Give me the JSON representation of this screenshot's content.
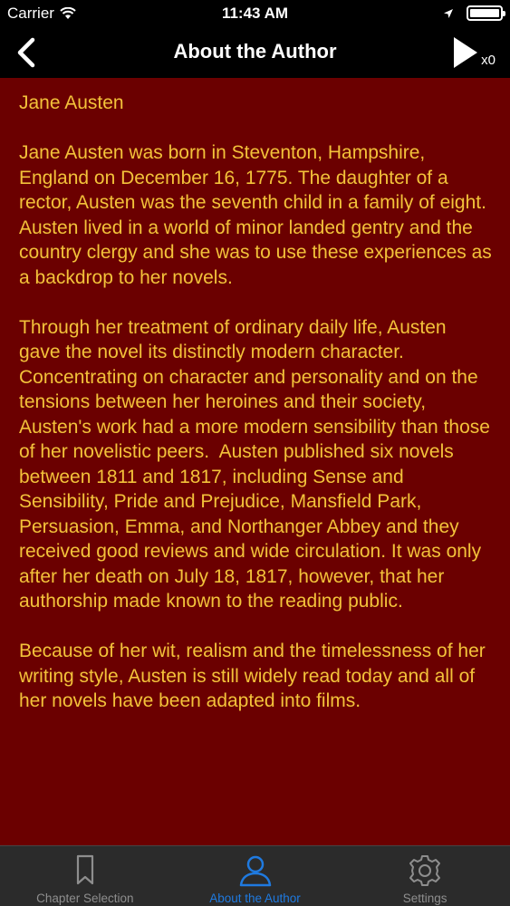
{
  "status_bar": {
    "carrier": "Carrier",
    "time": "11:43 AM",
    "battery_level": 1.0
  },
  "nav": {
    "title": "About the Author",
    "play_count": "x0"
  },
  "content": {
    "author_name": "Jane Austen",
    "paragraphs": [
      "Jane Austen was born in Steventon, Hampshire, England on December 16, 1775. The daughter of a rector, Austen was the seventh child in a family of eight. Austen lived in a world of minor landed gentry and the country clergy and she was to use these experiences as a backdrop to her novels.",
      "Through her treatment of ordinary daily life, Austen gave the novel its distinctly modern character. Concentrating on character and personality and on the tensions between her heroines and their society, Austen's work had a more modern sensibility than those of her novelistic peers.  Austen published six novels between 1811 and 1817, including Sense and Sensibility, Pride and Prejudice, Mansfield Park, Persuasion, Emma, and Northanger Abbey and they received good reviews and wide circulation. It was only after her death on July 18, 1817, however, that her authorship made known to the reading public.",
      "Because of her wit, realism and the timelessness of her writing style, Austen is still widely read today and all of her novels have been adapted into films."
    ]
  },
  "tabs": [
    {
      "label": "Chapter Selection",
      "icon": "bookmark-icon",
      "active": false
    },
    {
      "label": "About the Author",
      "icon": "person-icon",
      "active": true
    },
    {
      "label": "Settings",
      "icon": "gear-icon",
      "active": false
    }
  ],
  "colors": {
    "background": "#6b0000",
    "text": "#f3c23a",
    "bars": "#000000",
    "tab_bar": "#2b2b2b",
    "tab_active": "#1f7ae0",
    "tab_inactive": "#8e8e8e"
  }
}
